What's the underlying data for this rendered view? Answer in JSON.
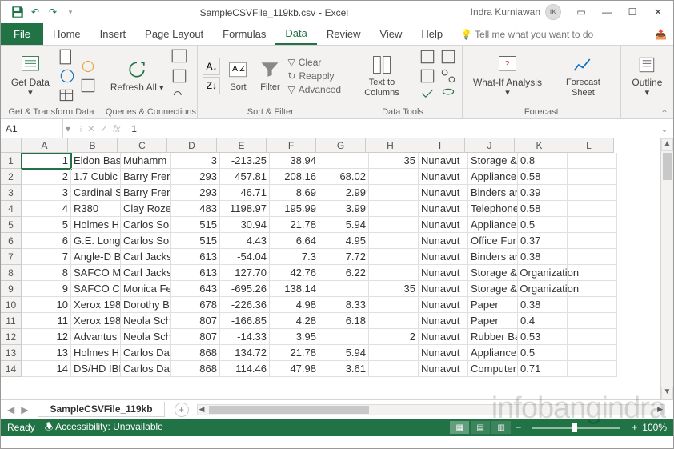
{
  "titlebar": {
    "filename": "SampleCSVFile_119kb.csv",
    "app": "Excel",
    "user": "Indra Kurniawan",
    "user_initials": "IK"
  },
  "tabs": {
    "file": "File",
    "items": [
      "Home",
      "Insert",
      "Page Layout",
      "Formulas",
      "Data",
      "Review",
      "View",
      "Help"
    ],
    "active": "Data",
    "tellme": "Tell me what you want to do"
  },
  "ribbon": {
    "g1": {
      "label": "Get & Transform Data",
      "btn": "Get\nData"
    },
    "g2": {
      "label": "Queries & Connections",
      "btn": "Refresh\nAll"
    },
    "g3": {
      "label": "Sort & Filter",
      "sort": "Sort",
      "filter": "Filter",
      "clear": "Clear",
      "reapply": "Reapply",
      "advanced": "Advanced"
    },
    "g4": {
      "label": "Data Tools",
      "ttc": "Text to\nColumns"
    },
    "g5": {
      "label": "Forecast",
      "whatif": "What-If\nAnalysis",
      "forecast": "Forecast\nSheet"
    },
    "g6": {
      "outline": "Outline"
    }
  },
  "fx": {
    "name": "A1",
    "formula": "1"
  },
  "cols": [
    "A",
    "B",
    "C",
    "D",
    "E",
    "F",
    "G",
    "H",
    "I",
    "J",
    "K",
    "L"
  ],
  "rows": [
    {
      "n": 1,
      "A": "1",
      "B": "Eldon Bas",
      "C": "Muhamm",
      "D": "3",
      "E": "-213.25",
      "F": "38.94",
      "G": "",
      "H": "35",
      "I": "Nunavut",
      "J": "Storage &",
      "K": "0.8"
    },
    {
      "n": 2,
      "A": "2",
      "B": "1.7 Cubic",
      "C": "Barry Fren",
      "D": "293",
      "E": "457.81",
      "F": "208.16",
      "G": "68.02",
      "H": "",
      "I": "Nunavut",
      "J": "Appliance",
      "K": "0.58"
    },
    {
      "n": 3,
      "A": "3",
      "B": "Cardinal S",
      "C": "Barry Fren",
      "D": "293",
      "E": "46.71",
      "F": "8.69",
      "G": "2.99",
      "H": "",
      "I": "Nunavut",
      "J": "Binders an",
      "K": "0.39"
    },
    {
      "n": 4,
      "A": "4",
      "B": "R380",
      "C": "Clay Rozer",
      "D": "483",
      "E": "1198.97",
      "F": "195.99",
      "G": "3.99",
      "H": "",
      "I": "Nunavut",
      "J": "Telephone",
      "K": "0.58"
    },
    {
      "n": 5,
      "A": "5",
      "B": "Holmes H",
      "C": "Carlos Sol",
      "D": "515",
      "E": "30.94",
      "F": "21.78",
      "G": "5.94",
      "H": "",
      "I": "Nunavut",
      "J": "Appliance",
      "K": "0.5"
    },
    {
      "n": 6,
      "A": "6",
      "B": "G.E. Longe",
      "C": "Carlos Sol",
      "D": "515",
      "E": "4.43",
      "F": "6.64",
      "G": "4.95",
      "H": "",
      "I": "Nunavut",
      "J": "Office Fur",
      "K": "0.37"
    },
    {
      "n": 7,
      "A": "7",
      "B": "Angle-D B",
      "C": "Carl Jackso",
      "D": "613",
      "E": "-54.04",
      "F": "7.3",
      "G": "7.72",
      "H": "",
      "I": "Nunavut",
      "J": "Binders an",
      "K": "0.38"
    },
    {
      "n": 8,
      "A": "8",
      "B": "SAFCO Mc",
      "C": "Carl Jackso",
      "D": "613",
      "E": "127.70",
      "F": "42.76",
      "G": "6.22",
      "H": "",
      "I": "Nunavut",
      "J": "Storage & Organization",
      "K": ""
    },
    {
      "n": 9,
      "A": "9",
      "B": "SAFCO Co",
      "C": "Monica Fe",
      "D": "643",
      "E": "-695.26",
      "F": "138.14",
      "G": "",
      "H": "35",
      "I": "Nunavut",
      "J": "Storage & Organization",
      "K": ""
    },
    {
      "n": 10,
      "A": "10",
      "B": "Xerox 198",
      "C": "Dorothy B",
      "D": "678",
      "E": "-226.36",
      "F": "4.98",
      "G": "8.33",
      "H": "",
      "I": "Nunavut",
      "J": "Paper",
      "K": "0.38"
    },
    {
      "n": 11,
      "A": "11",
      "B": "Xerox 198",
      "C": "Neola Sch",
      "D": "807",
      "E": "-166.85",
      "F": "4.28",
      "G": "6.18",
      "H": "",
      "I": "Nunavut",
      "J": "Paper",
      "K": "0.4"
    },
    {
      "n": 12,
      "A": "12",
      "B": "Advantus",
      "C": "Neola Sch",
      "D": "807",
      "E": "-14.33",
      "F": "3.95",
      "G": "",
      "H": "2",
      "I": "Nunavut",
      "J": "Rubber Ba",
      "K": "0.53"
    },
    {
      "n": 13,
      "A": "13",
      "B": "Holmes H",
      "C": "Carlos Dal",
      "D": "868",
      "E": "134.72",
      "F": "21.78",
      "G": "5.94",
      "H": "",
      "I": "Nunavut",
      "J": "Appliance",
      "K": "0.5"
    },
    {
      "n": 14,
      "A": "14",
      "B": "DS/HD IBN",
      "C": "Carlos Dal",
      "D": "868",
      "E": "114.46",
      "F": "47.98",
      "G": "3.61",
      "H": "",
      "I": "Nunavut",
      "J": "Computer",
      "K": "0.71"
    }
  ],
  "sheet": {
    "name": "SampleCSVFile_119kb"
  },
  "status": {
    "ready": "Ready",
    "accessibility": "Accessibility: Unavailable",
    "zoom": "100%"
  },
  "watermark": "infobangindra"
}
